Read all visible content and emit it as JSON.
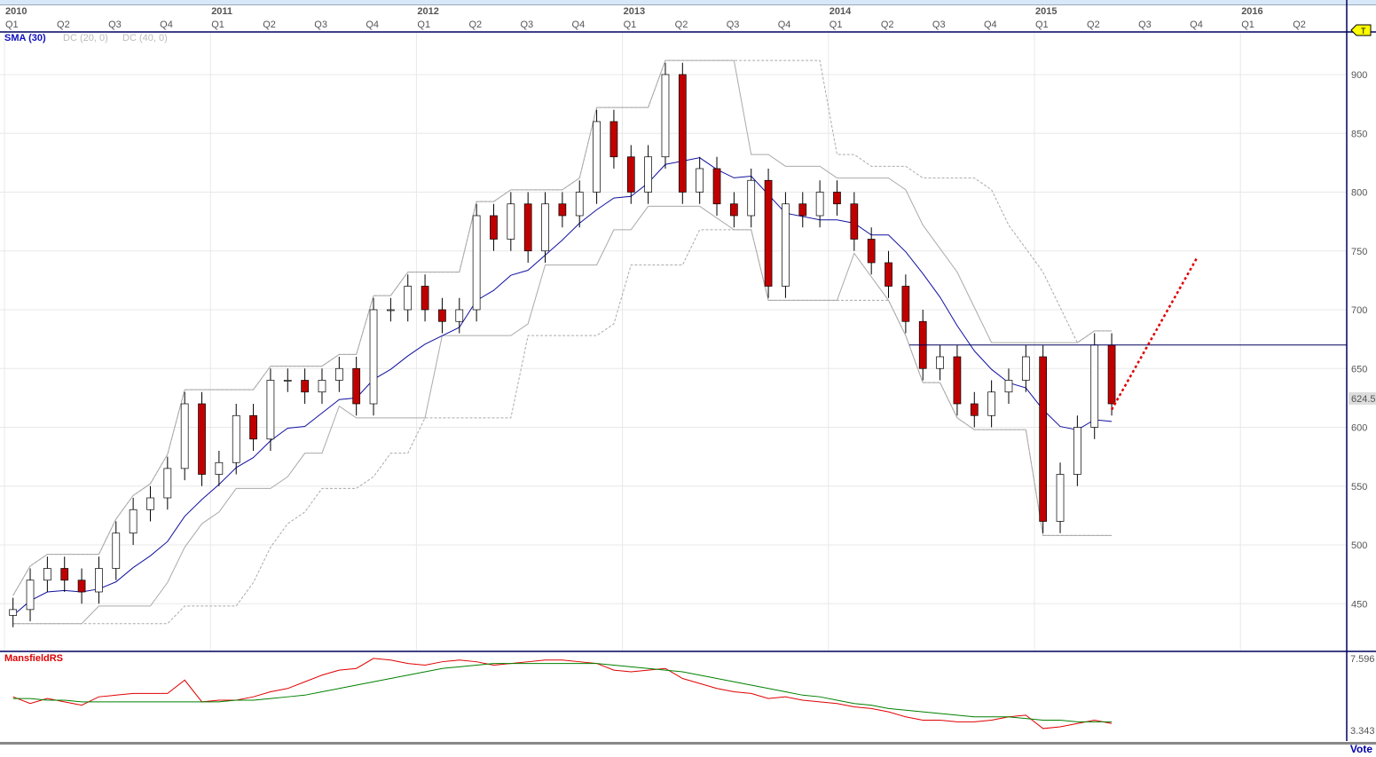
{
  "years": [
    {
      "label": "2010",
      "idx": 0
    },
    {
      "label": "2011",
      "idx": 12
    },
    {
      "label": "2012",
      "idx": 24
    },
    {
      "label": "2013",
      "idx": 36
    },
    {
      "label": "2014",
      "idx": 48
    },
    {
      "label": "2015",
      "idx": 60
    },
    {
      "label": "2016",
      "idx": 72
    }
  ],
  "quarters": [
    "Q1",
    "Q2",
    "Q3",
    "Q4"
  ],
  "indicators": {
    "sma": "SMA (30)",
    "dc1": "DC (20, 0)",
    "dc2": "DC (40, 0)",
    "rs": "MansfieldRS"
  },
  "price_tag": "624.5",
  "flag": "T",
  "rs_labels": {
    "max": "7.596",
    "min": "3.343"
  },
  "vote": "Vote",
  "colors": {
    "sma": "#1010a0",
    "down": "#c00000",
    "rs": "#e00000",
    "rs_ma": "#008000",
    "grid": "#e8e8e8",
    "axis": "#000060"
  },
  "chart_data": {
    "type": "candlestick",
    "interval": "monthly-approx",
    "ylim": [
      420,
      935
    ],
    "yticks": [
      450,
      500,
      550,
      600,
      650,
      700,
      750,
      800,
      850,
      900
    ],
    "closes": [
      445,
      470,
      480,
      470,
      460,
      480,
      510,
      530,
      540,
      565,
      620,
      560,
      570,
      610,
      590,
      640,
      640,
      630,
      640,
      650,
      620,
      700,
      700,
      720,
      700,
      690,
      700,
      780,
      760,
      790,
      750,
      790,
      780,
      800,
      860,
      830,
      800,
      830,
      900,
      800,
      820,
      790,
      780,
      810,
      720,
      790,
      780,
      800,
      790,
      760,
      740,
      720,
      690,
      650,
      660,
      620,
      610,
      630,
      640,
      660,
      520,
      560,
      600,
      670,
      620
    ],
    "hline": 670,
    "projection": [
      [
        64,
        615
      ],
      [
        69,
        745
      ]
    ],
    "rs": {
      "ylim": [
        3.343,
        7.596
      ],
      "values": [
        5.3,
        4.9,
        5.2,
        5.0,
        4.8,
        5.3,
        5.4,
        5.5,
        5.5,
        5.5,
        6.3,
        5.0,
        5.1,
        5.1,
        5.3,
        5.6,
        5.8,
        6.2,
        6.6,
        6.9,
        7.0,
        7.6,
        7.5,
        7.3,
        7.2,
        7.4,
        7.5,
        7.4,
        7.2,
        7.3,
        7.4,
        7.5,
        7.5,
        7.4,
        7.3,
        6.9,
        6.8,
        6.9,
        7.0,
        6.4,
        6.1,
        5.8,
        5.6,
        5.5,
        5.2,
        5.3,
        5.1,
        5.0,
        4.9,
        4.7,
        4.6,
        4.4,
        4.1,
        3.9,
        3.9,
        3.8,
        3.8,
        3.9,
        4.1,
        4.2,
        3.4,
        3.5,
        3.7,
        3.9,
        3.7
      ],
      "ma": [
        5.2,
        5.2,
        5.1,
        5.1,
        5.0,
        5.0,
        5.0,
        5.0,
        5.0,
        5.0,
        5.0,
        5.0,
        5.0,
        5.1,
        5.1,
        5.2,
        5.3,
        5.4,
        5.6,
        5.8,
        6.0,
        6.2,
        6.4,
        6.6,
        6.8,
        7.0,
        7.1,
        7.2,
        7.3,
        7.3,
        7.3,
        7.3,
        7.3,
        7.3,
        7.3,
        7.2,
        7.1,
        7.0,
        6.9,
        6.8,
        6.6,
        6.4,
        6.2,
        6.0,
        5.8,
        5.6,
        5.4,
        5.3,
        5.1,
        4.9,
        4.8,
        4.6,
        4.5,
        4.4,
        4.3,
        4.2,
        4.1,
        4.1,
        4.1,
        4.0,
        3.9,
        3.9,
        3.8,
        3.8,
        3.8
      ]
    }
  }
}
